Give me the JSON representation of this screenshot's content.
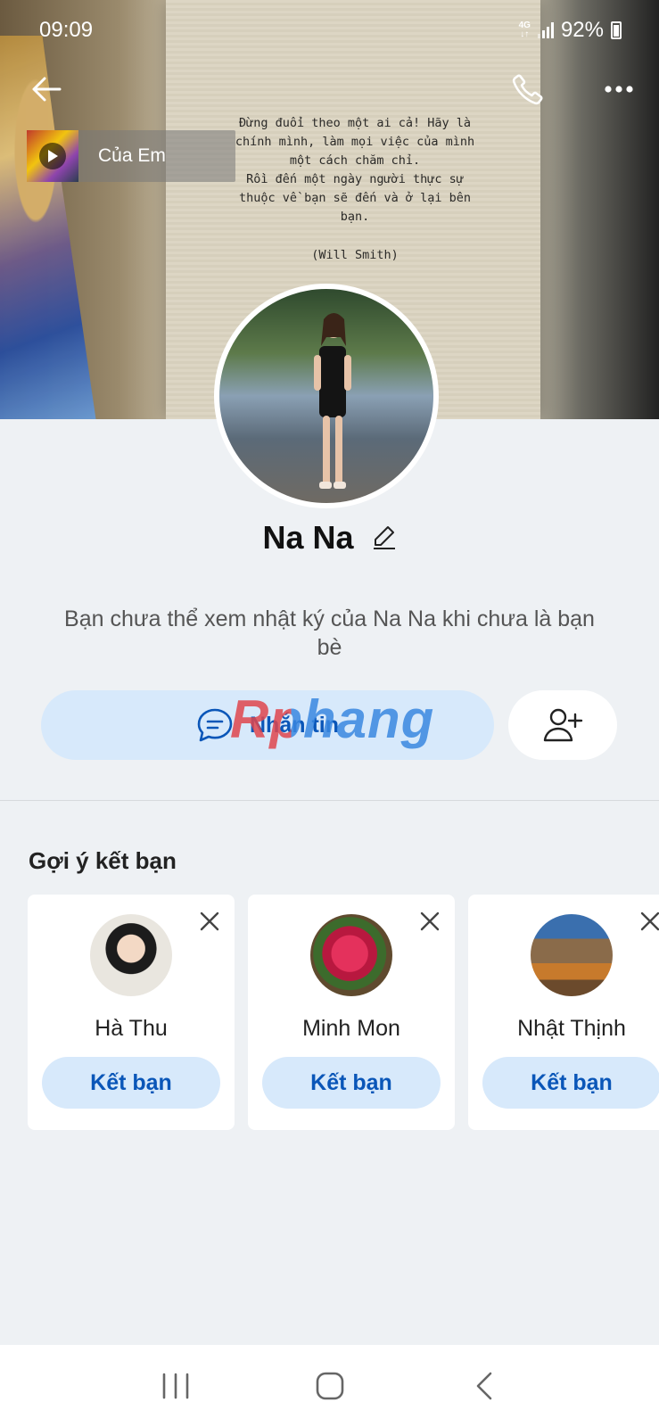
{
  "status_bar": {
    "time": "09:09",
    "network": "4G",
    "battery": "92%"
  },
  "cover": {
    "quote_lines": [
      "Đừng đuổi theo một ai cả! Hãy là",
      "chính mình, làm mọi việc của mình",
      "một cách chăm chỉ.",
      "Rồi đến một ngày người thực sự",
      "thuộc về bạn sẽ đến và ở lại bên",
      "bạn."
    ],
    "quote_author": "(Will Smith)"
  },
  "music": {
    "title": "Của Em"
  },
  "profile": {
    "name": "Na Na",
    "notice": "Bạn chưa thể xem nhật ký của Na Na khi chưa là bạn bè",
    "message_label": "Nhắn tin"
  },
  "watermark": "Rphang",
  "suggestions": {
    "title": "Gợi ý kết bạn",
    "items": [
      {
        "name": "Hà Thu",
        "button": "Kết bạn"
      },
      {
        "name": "Minh Mon",
        "button": "Kết bạn"
      },
      {
        "name": "Nhật Thịnh",
        "button": "Kết bạn"
      }
    ]
  },
  "colors": {
    "accent": "#0a56b8",
    "button_bg": "#d7e9fb",
    "page_bg": "#eef1f4"
  }
}
